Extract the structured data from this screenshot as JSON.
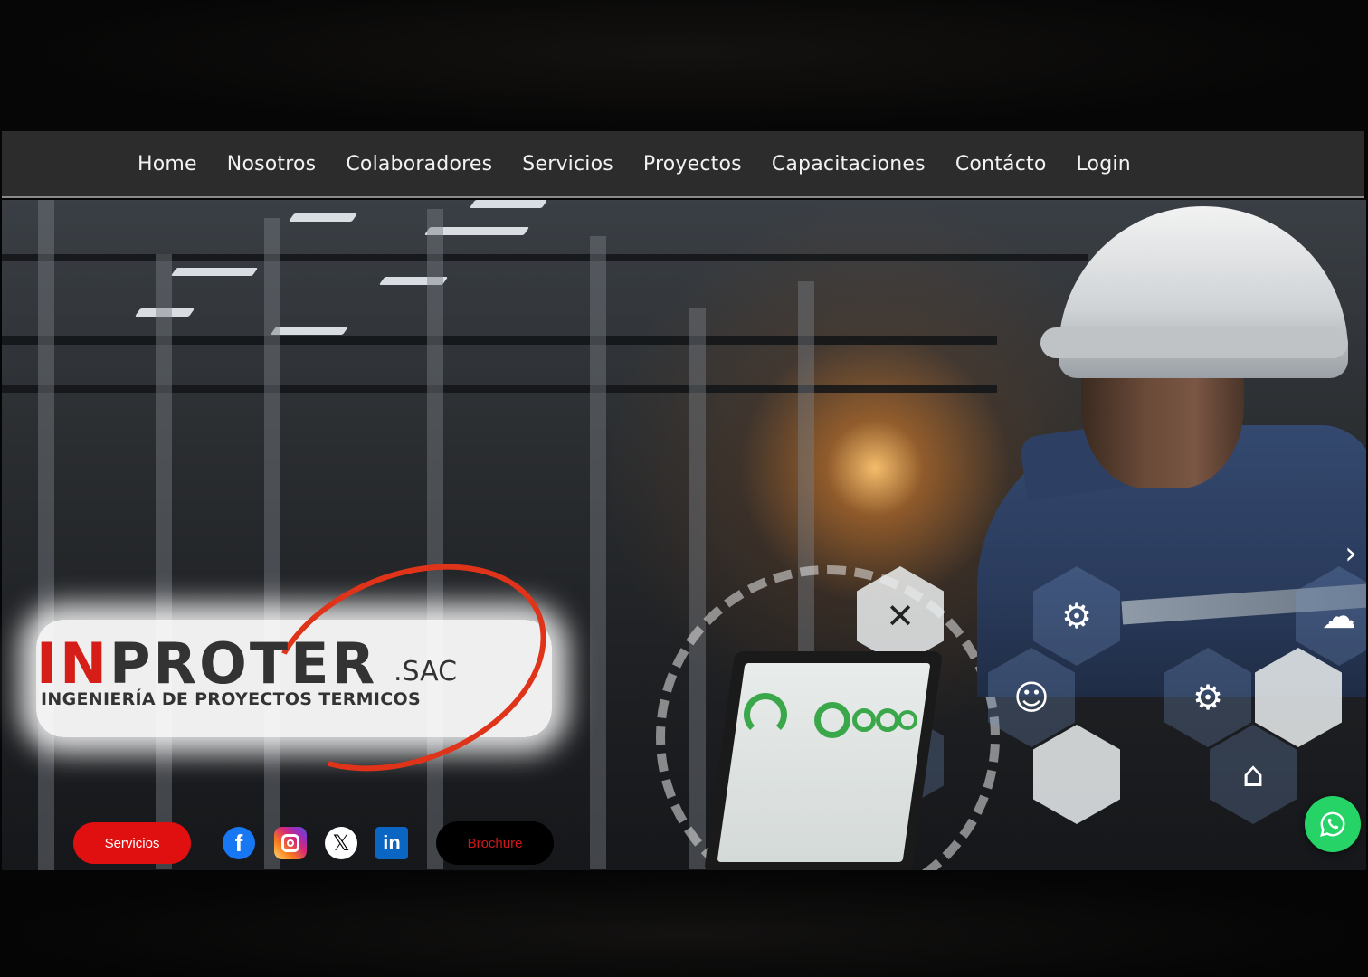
{
  "nav": {
    "items": [
      {
        "label": "Home"
      },
      {
        "label": "Nosotros"
      },
      {
        "label": "Colaboradores"
      },
      {
        "label": "Servicios"
      },
      {
        "label": "Proyectos"
      },
      {
        "label": "Capacitaciones"
      },
      {
        "label": "Contácto"
      },
      {
        "label": "Login"
      }
    ]
  },
  "logo": {
    "brand_red": "IN",
    "brand_dark": "PROTER",
    "suffix": ".SAC",
    "tagline": "INGENIERÍA DE PROYECTOS TERMICOS"
  },
  "actions": {
    "servicios_label": "Servicios",
    "brochure_label": "Brochure"
  },
  "social": [
    {
      "icon": "facebook-icon",
      "glyph": "f"
    },
    {
      "icon": "instagram-icon"
    },
    {
      "icon": "x-icon",
      "glyph": "𝕏"
    },
    {
      "icon": "linkedin-icon",
      "glyph": "in"
    }
  ],
  "slider": {
    "next_glyph": "›"
  },
  "colors": {
    "nav_bg": "#2c2c2c",
    "accent_red": "#e01010",
    "whatsapp_green": "#25d366"
  }
}
